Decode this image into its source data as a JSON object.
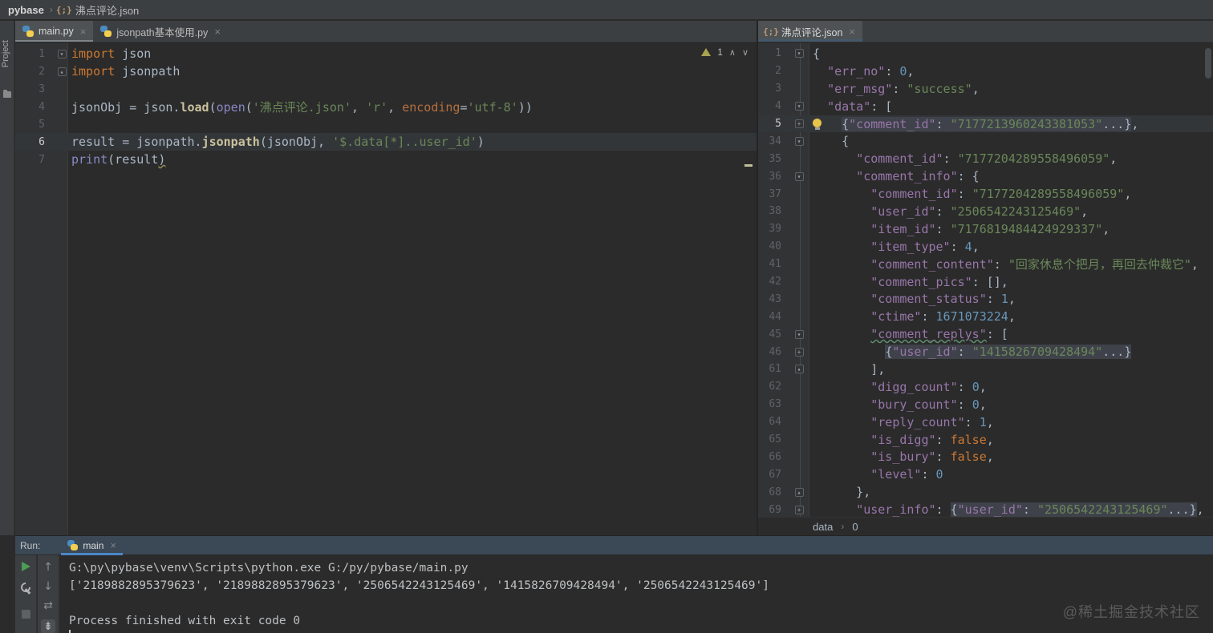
{
  "colors": {
    "accent_blue": "#4A88C7",
    "keyword_orange": "#CC7832",
    "string_green": "#6A8759",
    "key_purple": "#9876AA",
    "number_blue": "#6897BB",
    "warning_olive": "#A8A34F",
    "run_header_blue": "#3B4855"
  },
  "top_breadcrumb": {
    "project": "pybase",
    "file": "沸点评论.json"
  },
  "project_stripe": {
    "label": "Project"
  },
  "left_editor": {
    "tabs": [
      {
        "label": "main.py"
      },
      {
        "label": "jsonpath基本使用.py"
      }
    ],
    "close_glyph": "×",
    "inspection": {
      "warning_count": "1",
      "up": "∧",
      "down": "∨"
    },
    "lines": [
      {
        "n": "1",
        "fold": "open",
        "t": [
          [
            "k",
            "import"
          ],
          [
            "p",
            " json"
          ]
        ]
      },
      {
        "n": "2",
        "fold": "end",
        "t": [
          [
            "k",
            "import"
          ],
          [
            "p",
            " jsonpath"
          ]
        ]
      },
      {
        "n": "3",
        "t": []
      },
      {
        "n": "4",
        "t": [
          [
            "p",
            "jsonObj = json."
          ],
          [
            "f",
            "load"
          ],
          [
            "p",
            "("
          ],
          [
            "b",
            "open"
          ],
          [
            "p",
            "("
          ],
          [
            "s",
            "'沸点评论.json'"
          ],
          [
            "p",
            ", "
          ],
          [
            "s",
            "'r'"
          ],
          [
            "p",
            ", "
          ],
          [
            "nm",
            "encoding"
          ],
          [
            "p",
            "="
          ],
          [
            "s",
            "'utf-8'"
          ],
          [
            "p",
            "))"
          ]
        ]
      },
      {
        "n": "5",
        "t": []
      },
      {
        "n": "6",
        "hl": true,
        "t": [
          [
            "p",
            "result = jsonpath."
          ],
          [
            "f",
            "jsonpath"
          ],
          [
            "p",
            "(jsonObj, "
          ],
          [
            "s",
            "'$.data[*]..user_id'"
          ],
          [
            "p",
            ")"
          ]
        ]
      },
      {
        "n": "7",
        "t": [
          [
            "b",
            "print"
          ],
          [
            "p",
            "(result"
          ],
          [
            "pw",
            ")"
          ]
        ]
      }
    ]
  },
  "right_editor": {
    "tabs": [
      {
        "label": "沸点评论.json"
      }
    ],
    "close_glyph": "×",
    "breadcrumb": {
      "first": "data",
      "sep": "›",
      "second": "0"
    },
    "lines": [
      {
        "n": "1",
        "fold": "open",
        "t": [
          [
            "p",
            "{"
          ]
        ]
      },
      {
        "n": "2",
        "t": [
          [
            "p",
            "  "
          ],
          [
            "key",
            "\"err_no\""
          ],
          [
            "p",
            ": "
          ],
          [
            "n",
            "0"
          ],
          [
            "p",
            ","
          ]
        ]
      },
      {
        "n": "3",
        "t": [
          [
            "p",
            "  "
          ],
          [
            "key",
            "\"err_msg\""
          ],
          [
            "p",
            ": "
          ],
          [
            "s",
            "\"success\""
          ],
          [
            "p",
            ","
          ]
        ]
      },
      {
        "n": "4",
        "fold": "open",
        "t": [
          [
            "p",
            "  "
          ],
          [
            "key",
            "\"data\""
          ],
          [
            "p",
            ": ["
          ]
        ]
      },
      {
        "n": "5",
        "fold": "plus",
        "hl": true,
        "bulb": true,
        "t": [
          [
            "p",
            "    "
          ],
          [
            "pF",
            "{"
          ],
          [
            "keyF",
            "\"comment_id\""
          ],
          [
            "pF",
            ": "
          ],
          [
            "sF",
            "\"7177213960243381053\""
          ],
          [
            "pF",
            "...}"
          ],
          [
            "p",
            ","
          ]
        ]
      },
      {
        "n": "34",
        "fold": "open",
        "t": [
          [
            "p",
            "    {"
          ]
        ]
      },
      {
        "n": "35",
        "t": [
          [
            "p",
            "      "
          ],
          [
            "key",
            "\"comment_id\""
          ],
          [
            "p",
            ": "
          ],
          [
            "s",
            "\"7177204289558496059\""
          ],
          [
            "p",
            ","
          ]
        ]
      },
      {
        "n": "36",
        "fold": "open",
        "t": [
          [
            "p",
            "      "
          ],
          [
            "key",
            "\"comment_info\""
          ],
          [
            "p",
            ": {"
          ]
        ]
      },
      {
        "n": "37",
        "t": [
          [
            "p",
            "        "
          ],
          [
            "key",
            "\"comment_id\""
          ],
          [
            "p",
            ": "
          ],
          [
            "s",
            "\"7177204289558496059\""
          ],
          [
            "p",
            ","
          ]
        ]
      },
      {
        "n": "38",
        "t": [
          [
            "p",
            "        "
          ],
          [
            "key",
            "\"user_id\""
          ],
          [
            "p",
            ": "
          ],
          [
            "s",
            "\"2506542243125469\""
          ],
          [
            "p",
            ","
          ]
        ]
      },
      {
        "n": "39",
        "t": [
          [
            "p",
            "        "
          ],
          [
            "key",
            "\"item_id\""
          ],
          [
            "p",
            ": "
          ],
          [
            "s",
            "\"7176819484424929337\""
          ],
          [
            "p",
            ","
          ]
        ]
      },
      {
        "n": "40",
        "t": [
          [
            "p",
            "        "
          ],
          [
            "key",
            "\"item_type\""
          ],
          [
            "p",
            ": "
          ],
          [
            "n",
            "4"
          ],
          [
            "p",
            ","
          ]
        ]
      },
      {
        "n": "41",
        "t": [
          [
            "p",
            "        "
          ],
          [
            "key",
            "\"comment_content\""
          ],
          [
            "p",
            ": "
          ],
          [
            "s",
            "\"回家休息个把月，再回去仲裁它\""
          ],
          [
            "p",
            ","
          ]
        ]
      },
      {
        "n": "42",
        "t": [
          [
            "p",
            "        "
          ],
          [
            "key",
            "\"comment_pics\""
          ],
          [
            "p",
            ": [],"
          ]
        ]
      },
      {
        "n": "43",
        "t": [
          [
            "p",
            "        "
          ],
          [
            "key",
            "\"comment_status\""
          ],
          [
            "p",
            ": "
          ],
          [
            "n",
            "1"
          ],
          [
            "p",
            ","
          ]
        ]
      },
      {
        "n": "44",
        "t": [
          [
            "p",
            "        "
          ],
          [
            "key",
            "\"ctime\""
          ],
          [
            "p",
            ": "
          ],
          [
            "n",
            "1671073224"
          ],
          [
            "p",
            ","
          ]
        ]
      },
      {
        "n": "45",
        "fold": "open",
        "t": [
          [
            "p",
            "        "
          ],
          [
            "keyw",
            "\"comment_replys\""
          ],
          [
            "p",
            ": ["
          ]
        ]
      },
      {
        "n": "46",
        "fold": "plus",
        "t": [
          [
            "p",
            "          "
          ],
          [
            "pF",
            "{"
          ],
          [
            "keyF",
            "\"user_id\""
          ],
          [
            "pF",
            ": "
          ],
          [
            "sF",
            "\"1415826709428494\""
          ],
          [
            "pF",
            "...}"
          ]
        ]
      },
      {
        "n": "61",
        "fold": "end",
        "t": [
          [
            "p",
            "        ],"
          ]
        ]
      },
      {
        "n": "62",
        "t": [
          [
            "p",
            "        "
          ],
          [
            "key",
            "\"digg_count\""
          ],
          [
            "p",
            ": "
          ],
          [
            "n",
            "0"
          ],
          [
            "p",
            ","
          ]
        ]
      },
      {
        "n": "63",
        "t": [
          [
            "p",
            "        "
          ],
          [
            "key",
            "\"bury_count\""
          ],
          [
            "p",
            ": "
          ],
          [
            "n",
            "0"
          ],
          [
            "p",
            ","
          ]
        ]
      },
      {
        "n": "64",
        "t": [
          [
            "p",
            "        "
          ],
          [
            "key",
            "\"reply_count\""
          ],
          [
            "p",
            ": "
          ],
          [
            "n",
            "1"
          ],
          [
            "p",
            ","
          ]
        ]
      },
      {
        "n": "65",
        "t": [
          [
            "p",
            "        "
          ],
          [
            "key",
            "\"is_digg\""
          ],
          [
            "p",
            ": "
          ],
          [
            "bool",
            "false"
          ],
          [
            "p",
            ","
          ]
        ]
      },
      {
        "n": "66",
        "t": [
          [
            "p",
            "        "
          ],
          [
            "key",
            "\"is_bury\""
          ],
          [
            "p",
            ": "
          ],
          [
            "bool",
            "false"
          ],
          [
            "p",
            ","
          ]
        ]
      },
      {
        "n": "67",
        "t": [
          [
            "p",
            "        "
          ],
          [
            "key",
            "\"level\""
          ],
          [
            "p",
            ": "
          ],
          [
            "n",
            "0"
          ]
        ]
      },
      {
        "n": "68",
        "fold": "end",
        "t": [
          [
            "p",
            "      },"
          ]
        ]
      },
      {
        "n": "69",
        "fold": "plus",
        "t": [
          [
            "p",
            "      "
          ],
          [
            "key",
            "\"user_info\""
          ],
          [
            "p",
            ": "
          ],
          [
            "pF",
            "{"
          ],
          [
            "keyF",
            "\"user_id\""
          ],
          [
            "pF",
            ": "
          ],
          [
            "sF",
            "\"2506542243125469\""
          ],
          [
            "pF",
            "...}"
          ],
          [
            "p",
            ","
          ]
        ]
      }
    ]
  },
  "run_panel": {
    "label": "Run:",
    "tab": {
      "label": "main",
      "close_glyph": "×"
    },
    "console": [
      {
        "text": "G:\\py\\pybase\\venv\\Scripts\\python.exe G:/py/pybase/main.py"
      },
      {
        "text": "['2189882895379623', '2189882895379623', '2506542243125469', '1415826709428494', '2506542243125469']"
      },
      {
        "text": ""
      },
      {
        "text": "Process finished with exit code 0"
      }
    ],
    "toolbar2_glyphs": {
      "up": "↑",
      "down": "↓",
      "softwrap": "⇄",
      "scroll_end": "⇟"
    }
  },
  "watermark": "@稀土掘金技术社区"
}
